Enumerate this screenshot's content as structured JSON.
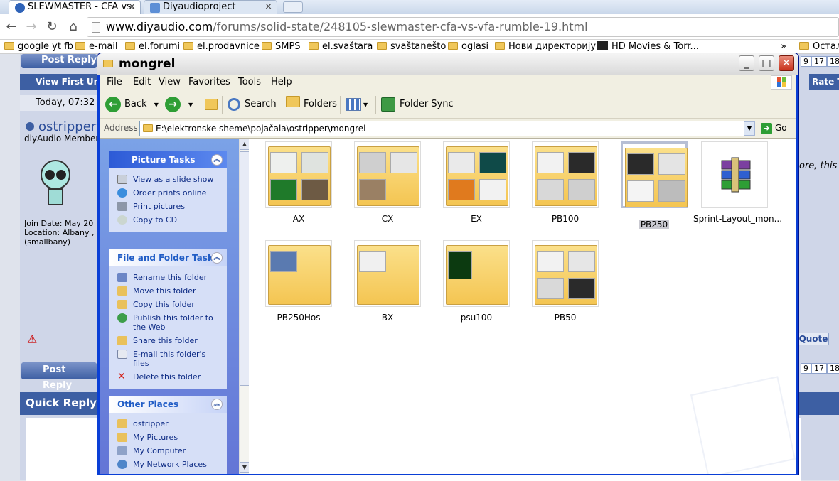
{
  "browser": {
    "tabs": [
      {
        "label": "SLEWMASTER - CFA vs.",
        "active": true
      },
      {
        "label": "Diyaudioproject",
        "active": false
      }
    ],
    "url_host": "www.diyaudio.com",
    "url_path": "/forums/solid-state/248105-slewmaster-cfa-vs-vfa-rumble-19.html",
    "bookmarks": [
      "google yt fb",
      "e-mail",
      "el.forumi",
      "el.prodavnice",
      "SMPS",
      "el.svaštara",
      "svaštanešto",
      "oglasi",
      "Нови директоријум",
      "HD Movies & Torr...",
      "»",
      "Остал"
    ]
  },
  "forum": {
    "post_reply": "Post Reply",
    "view_first_unread": "View First Un",
    "today": "Today, 07:32",
    "username": "ostripper",
    "member_title": "diyAudio Member",
    "join_date": "Join Date: May 20",
    "location": "Location: Albany ,",
    "location2": "(smallbany)",
    "rate": "Rate T",
    "quick_reply": "Quick Reply",
    "quote": "Quote",
    "excerpt": "ore, this",
    "pages": [
      "9",
      "17",
      "18"
    ]
  },
  "window": {
    "title": "mongrel",
    "menu": [
      "File",
      "Edit",
      "View",
      "Favorites",
      "Tools",
      "Help"
    ],
    "toolbar": {
      "back": "Back",
      "search": "Search",
      "folders": "Folders",
      "folder_sync": "Folder Sync"
    },
    "address_label": "Address",
    "address": "E:\\elektronske sheme\\pojačala\\ostripper\\mongrel",
    "go": "Go",
    "panels": [
      {
        "title": "Picture Tasks",
        "items": [
          "View as a slide show",
          "Order prints online",
          "Print pictures",
          "Copy to CD"
        ]
      },
      {
        "title": "File and Folder Tasks",
        "items": [
          "Rename this folder",
          "Move this folder",
          "Copy this folder",
          "Publish this folder to the Web",
          "Share this folder",
          "E-mail this folder's files",
          "Delete this folder"
        ]
      },
      {
        "title": "Other Places",
        "items": [
          "ostripper",
          "My Pictures",
          "My Computer",
          "My Network Places"
        ]
      }
    ],
    "files": [
      {
        "name": "AX",
        "type": "folder",
        "thumbs": [
          "#eef0ee",
          "#dfe3df",
          "#1f7a2a",
          "#6d5a44"
        ]
      },
      {
        "name": "CX",
        "type": "folder",
        "thumbs": [
          "#cfcfcf",
          "#e6e6e6",
          "#9a8064"
        ]
      },
      {
        "name": "EX",
        "type": "folder",
        "thumbs": [
          "#eaeaea",
          "#0f4a48",
          "#e07a1e",
          "#f2f2f2"
        ]
      },
      {
        "name": "PB100",
        "type": "folder",
        "thumbs": [
          "#f2f2f2",
          "#2a2a2a",
          "#d8d8d8",
          "#cfcfcf"
        ]
      },
      {
        "name": "PB250",
        "type": "folder",
        "selected": true,
        "thumbs": [
          "#2a2a2a",
          "#e4e4e4",
          "#f4f4f4",
          "#bcbcbc"
        ]
      },
      {
        "name": "Sprint-Layout_mon...",
        "type": "rar"
      },
      {
        "name": "PB250Hos",
        "type": "folder",
        "thumbs": [
          "#5a7ab0"
        ]
      },
      {
        "name": "BX",
        "type": "folder",
        "thumbs": [
          "#f0f0f0"
        ]
      },
      {
        "name": "psu100",
        "type": "folder",
        "thumbs": [
          "#0c3a10"
        ]
      },
      {
        "name": "PB50",
        "type": "folder",
        "thumbs": [
          "#f2f2f2",
          "#e6e6e6",
          "#d9d9d9",
          "#2a2a2a"
        ]
      }
    ]
  },
  "colors": {
    "xp_blue": "#0a3fd6",
    "folder_yellow": "#f4c552",
    "forum_blue": "#3d5fa3"
  }
}
